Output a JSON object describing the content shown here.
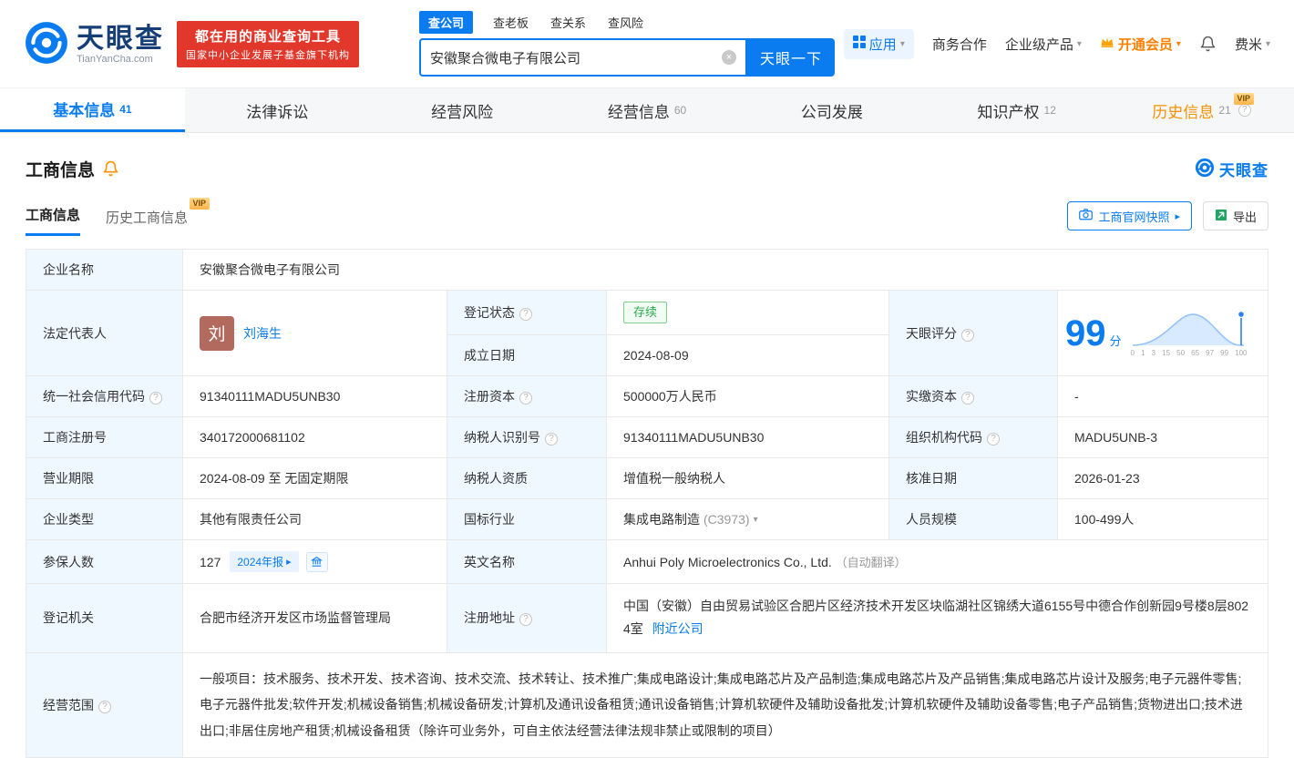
{
  "colors": {
    "accent_blue": "#0a7cf0",
    "vip_orange": "#f79100",
    "status_green": "#2fa84f",
    "brand_red": "#e2372b",
    "label_cell_bg": "#f0f8ff"
  },
  "brand": {
    "logo_cn": "天眼查",
    "logo_en": "TianYanCha.com",
    "slogan_line1": "都在用的商业查询工具",
    "slogan_line2": "国家中小企业发展子基金旗下机构"
  },
  "search": {
    "tabs": [
      "查公司",
      "查老板",
      "查关系",
      "查风险"
    ],
    "active_tab": "查公司",
    "value": "安徽聚合微电子有限公司",
    "button": "天眼一下"
  },
  "top_menu": {
    "apps": "应用",
    "cooperation": "商务合作",
    "enterprise": "企业级产品",
    "vip": "开通会员",
    "user": "费米"
  },
  "vip_badge": "VIP",
  "nav_tabs": [
    {
      "label": "基本信息",
      "count": "41",
      "active": true
    },
    {
      "label": "法律诉讼",
      "count": ""
    },
    {
      "label": "经营风险",
      "count": ""
    },
    {
      "label": "经营信息",
      "count": "60"
    },
    {
      "label": "公司发展",
      "count": ""
    },
    {
      "label": "知识产权",
      "count": "12"
    },
    {
      "label": "历史信息",
      "count": "21",
      "vip": true
    }
  ],
  "section": {
    "title": "工商信息",
    "subtabs": [
      {
        "label": "工商信息",
        "active": true
      },
      {
        "label": "历史工商信息",
        "vip": true
      }
    ],
    "snapshot_button": "工商官网快照",
    "export_button": "导出"
  },
  "company": {
    "name_label": "企业名称",
    "name": "安徽聚合微电子有限公司",
    "legal_rep_label": "法定代表人",
    "legal_rep_avatar": "刘",
    "legal_rep": "刘海生",
    "reg_status_label": "登记状态",
    "reg_status": "存续",
    "score_label": "天眼评分",
    "score": "99",
    "score_unit": "分",
    "est_date_label": "成立日期",
    "est_date": "2024-08-09",
    "credit_code_label": "统一社会信用代码",
    "credit_code": "91340111MADU5UNB30",
    "reg_capital_label": "注册资本",
    "reg_capital": "500000万人民币",
    "paid_capital_label": "实缴资本",
    "paid_capital": "-",
    "reg_number_label": "工商注册号",
    "reg_number": "340172000681102",
    "taxpayer_id_label": "纳税人识别号",
    "taxpayer_id": "91340111MADU5UNB30",
    "org_code_label": "组织机构代码",
    "org_code": "MADU5UNB-3",
    "business_term_label": "营业期限",
    "business_term": "2024-08-09 至 无固定期限",
    "taxpayer_quality_label": "纳税人资质",
    "taxpayer_quality": "增值税一般纳税人",
    "approval_date_label": "核准日期",
    "approval_date": "2026-01-23",
    "company_type_label": "企业类型",
    "company_type": "其他有限责任公司",
    "industry_label": "国标行业",
    "industry": "集成电路制造",
    "industry_code": "(C3973)",
    "staff_size_label": "人员规模",
    "staff_size": "100-499人",
    "insured_label": "参保人数",
    "insured": "127",
    "insured_tag": "2024年报",
    "en_name_label": "英文名称",
    "en_name": "Anhui Poly Microelectronics Co., Ltd.",
    "en_name_note": "（自动翻译）",
    "reg_authority_label": "登记机关",
    "reg_authority": "合肥市经济开发区市场监督管理局",
    "address_label": "注册地址",
    "address": "中国（安徽）自由贸易试验区合肥片区经济技术开发区块临湖社区锦绣大道6155号中德合作创新园9号楼8层8024室",
    "address_link": "附近公司",
    "scope_label": "经营范围",
    "scope": "一般项目：技术服务、技术开发、技术咨询、技术交流、技术转让、技术推广;集成电路设计;集成电路芯片及产品制造;集成电路芯片及产品销售;集成电路芯片设计及服务;电子元器件零售;电子元器件批发;软件开发;机械设备销售;机械设备研发;计算机及通讯设备租赁;通讯设备销售;计算机软硬件及辅助设备批发;计算机软硬件及辅助设备零售;电子产品销售;货物进出口;技术进出口;非居住房地产租赁;机械设备租赁（除许可业务外，可自主依法经营法律法规非禁止或限制的项目）"
  },
  "score_chart": {
    "ticks": [
      "0",
      "1",
      "3",
      "15",
      "50",
      "65",
      "97",
      "99",
      "100"
    ]
  }
}
